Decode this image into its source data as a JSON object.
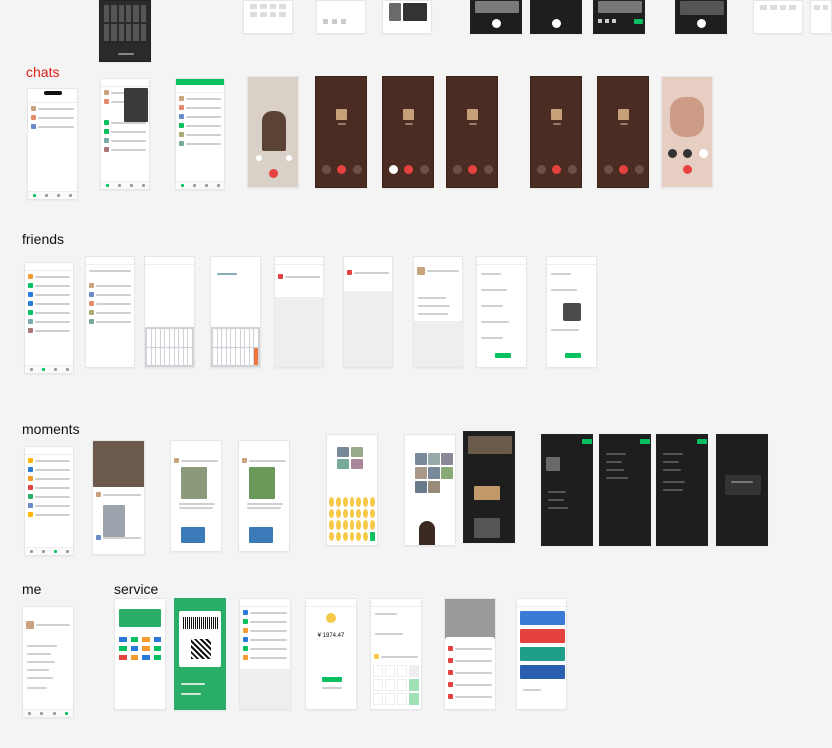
{
  "sections": {
    "chats": "chats",
    "friends": "friends",
    "moments": "moments",
    "me": "me",
    "service": "service"
  },
  "colors": {
    "active_label": "#e0201c",
    "wechat_green": "#07c160",
    "call_red": "#e5413f",
    "call_background": "#4a2c22",
    "dark_mode": "#1e1e1e"
  },
  "wallet": {
    "balance": "¥ 1974.47"
  }
}
